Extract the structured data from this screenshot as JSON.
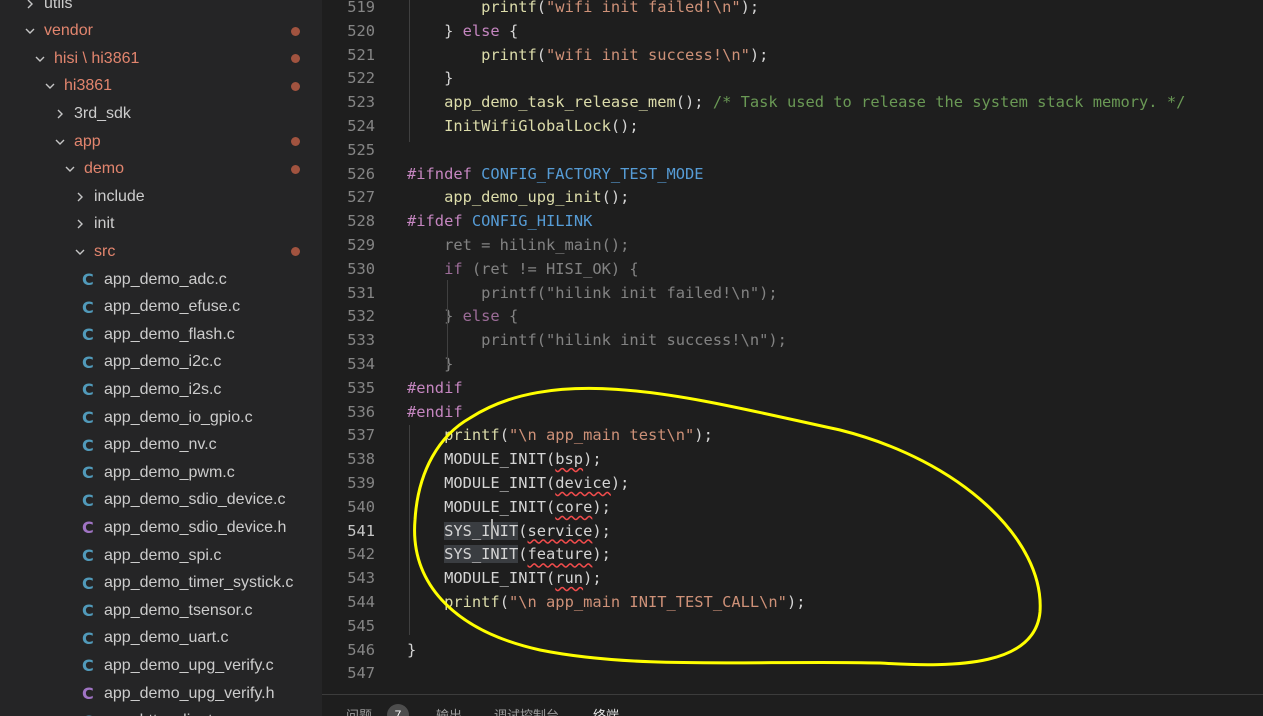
{
  "sidebar": {
    "items": [
      {
        "label": "utils",
        "kind": "folder",
        "expanded": false,
        "indent": 1,
        "modified": false
      },
      {
        "label": "vendor",
        "kind": "folder",
        "expanded": true,
        "indent": 1,
        "modified": true
      },
      {
        "label": "hisi \\ hi3861",
        "kind": "folder",
        "expanded": true,
        "indent": 2,
        "modified": true
      },
      {
        "label": "hi3861",
        "kind": "folder",
        "expanded": true,
        "indent": 3,
        "modified": true
      },
      {
        "label": "3rd_sdk",
        "kind": "folder",
        "expanded": false,
        "indent": 4,
        "modified": false
      },
      {
        "label": "app",
        "kind": "folder",
        "expanded": true,
        "indent": 4,
        "modified": true
      },
      {
        "label": "demo",
        "kind": "folder",
        "expanded": true,
        "indent": 5,
        "modified": true
      },
      {
        "label": "include",
        "kind": "folder",
        "expanded": false,
        "indent": 6,
        "modified": false
      },
      {
        "label": "init",
        "kind": "folder",
        "expanded": false,
        "indent": 6,
        "modified": false
      },
      {
        "label": "src",
        "kind": "folder",
        "expanded": true,
        "indent": 6,
        "modified": true
      },
      {
        "label": "app_demo_adc.c",
        "kind": "c",
        "indent": 7
      },
      {
        "label": "app_demo_efuse.c",
        "kind": "c",
        "indent": 7
      },
      {
        "label": "app_demo_flash.c",
        "kind": "c",
        "indent": 7
      },
      {
        "label": "app_demo_i2c.c",
        "kind": "c",
        "indent": 7
      },
      {
        "label": "app_demo_i2s.c",
        "kind": "c",
        "indent": 7
      },
      {
        "label": "app_demo_io_gpio.c",
        "kind": "c",
        "indent": 7
      },
      {
        "label": "app_demo_nv.c",
        "kind": "c",
        "indent": 7
      },
      {
        "label": "app_demo_pwm.c",
        "kind": "c",
        "indent": 7
      },
      {
        "label": "app_demo_sdio_device.c",
        "kind": "c",
        "indent": 7
      },
      {
        "label": "app_demo_sdio_device.h",
        "kind": "h",
        "indent": 7
      },
      {
        "label": "app_demo_spi.c",
        "kind": "c",
        "indent": 7
      },
      {
        "label": "app_demo_timer_systick.c",
        "kind": "c",
        "indent": 7
      },
      {
        "label": "app_demo_tsensor.c",
        "kind": "c",
        "indent": 7
      },
      {
        "label": "app_demo_uart.c",
        "kind": "c",
        "indent": 7
      },
      {
        "label": "app_demo_upg_verify.c",
        "kind": "c",
        "indent": 7
      },
      {
        "label": "app_demo_upg_verify.h",
        "kind": "h",
        "indent": 7
      },
      {
        "label": "app_http_client.c",
        "kind": "c",
        "indent": 7
      }
    ]
  },
  "file_icons": {
    "c": "C",
    "h": "C"
  },
  "editor": {
    "active_line": "541",
    "lines": [
      {
        "num": "519",
        "tokens": [
          {
            "t": "        "
          },
          {
            "t": "printf",
            "c": "fn"
          },
          {
            "t": "("
          },
          {
            "t": "\"wifi init failed!\\n\"",
            "c": "str"
          },
          {
            "t": ");"
          }
        ]
      },
      {
        "num": "520",
        "tokens": [
          {
            "t": "    } "
          },
          {
            "t": "else",
            "c": "kw"
          },
          {
            "t": " {"
          }
        ]
      },
      {
        "num": "521",
        "tokens": [
          {
            "t": "        "
          },
          {
            "t": "printf",
            "c": "fn"
          },
          {
            "t": "("
          },
          {
            "t": "\"wifi init success!\\n\"",
            "c": "str"
          },
          {
            "t": ");"
          }
        ]
      },
      {
        "num": "522",
        "tokens": [
          {
            "t": "    }"
          }
        ]
      },
      {
        "num": "523",
        "tokens": [
          {
            "t": "    "
          },
          {
            "t": "app_demo_task_release_mem",
            "c": "fn"
          },
          {
            "t": "(); "
          },
          {
            "t": "/* Task used to release the system stack memory. */",
            "c": "cm"
          }
        ]
      },
      {
        "num": "524",
        "tokens": [
          {
            "t": "    "
          },
          {
            "t": "InitWifiGlobalLock",
            "c": "fn"
          },
          {
            "t": "();"
          }
        ]
      },
      {
        "num": "525",
        "tokens": []
      },
      {
        "num": "526",
        "tokens": [
          {
            "t": "#ifndef",
            "c": "kw"
          },
          {
            "t": " "
          },
          {
            "t": "CONFIG_FACTORY_TEST_MODE",
            "c": "mac"
          }
        ]
      },
      {
        "num": "527",
        "tokens": [
          {
            "t": "    "
          },
          {
            "t": "app_demo_upg_init",
            "c": "fn"
          },
          {
            "t": "();"
          }
        ]
      },
      {
        "num": "528",
        "tokens": [
          {
            "t": "#ifdef",
            "c": "kw"
          },
          {
            "t": " "
          },
          {
            "t": "CONFIG_HILINK",
            "c": "mac"
          }
        ]
      },
      {
        "num": "529",
        "tokens": [
          {
            "t": "    ret = hilink_main();",
            "c": "dim"
          }
        ]
      },
      {
        "num": "530",
        "tokens": [
          {
            "t": "    "
          },
          {
            "t": "if",
            "c": "kwd"
          },
          {
            "t": " (ret != HISI_OK) {",
            "c": "dim"
          }
        ]
      },
      {
        "num": "531",
        "tokens": [
          {
            "t": "        printf(\"hilink init failed!\\n\");",
            "c": "dim"
          }
        ]
      },
      {
        "num": "532",
        "tokens": [
          {
            "t": "    } ",
            "c": "dim"
          },
          {
            "t": "else",
            "c": "kwd"
          },
          {
            "t": " {",
            "c": "dim"
          }
        ]
      },
      {
        "num": "533",
        "tokens": [
          {
            "t": "        printf(\"hilink init success!\\n\");",
            "c": "dim"
          }
        ]
      },
      {
        "num": "534",
        "tokens": [
          {
            "t": "    }",
            "c": "dim"
          }
        ]
      },
      {
        "num": "535",
        "tokens": [
          {
            "t": "#endif",
            "c": "kw"
          }
        ]
      },
      {
        "num": "536",
        "tokens": [
          {
            "t": "#endif",
            "c": "kw"
          }
        ]
      },
      {
        "num": "537",
        "tokens": [
          {
            "t": "    "
          },
          {
            "t": "printf",
            "c": "fn"
          },
          {
            "t": "("
          },
          {
            "t": "\"\\n app_main test\\n\"",
            "c": "str"
          },
          {
            "t": ");"
          }
        ]
      },
      {
        "num": "538",
        "tokens": [
          {
            "t": "    MODULE_INIT("
          },
          {
            "t": "bsp",
            "c": "sq"
          },
          {
            "t": ");"
          }
        ]
      },
      {
        "num": "539",
        "tokens": [
          {
            "t": "    MODULE_INIT("
          },
          {
            "t": "device",
            "c": "sq"
          },
          {
            "t": ");"
          }
        ]
      },
      {
        "num": "540",
        "tokens": [
          {
            "t": "    MODULE_INIT("
          },
          {
            "t": "core",
            "c": "sq"
          },
          {
            "t": ");"
          }
        ]
      },
      {
        "num": "541",
        "tokens": [
          {
            "t": "    "
          },
          {
            "t": "SYS_INIT",
            "c": "hl"
          },
          {
            "t": "("
          },
          {
            "t": "service",
            "c": "sq"
          },
          {
            "t": ");"
          }
        ]
      },
      {
        "num": "542",
        "tokens": [
          {
            "t": "    "
          },
          {
            "t": "SYS_INIT",
            "c": "hl"
          },
          {
            "t": "("
          },
          {
            "t": "feature",
            "c": "sq"
          },
          {
            "t": ");"
          }
        ]
      },
      {
        "num": "543",
        "tokens": [
          {
            "t": "    MODULE_INIT("
          },
          {
            "t": "run",
            "c": "sq"
          },
          {
            "t": ");"
          }
        ]
      },
      {
        "num": "544",
        "tokens": [
          {
            "t": "    "
          },
          {
            "t": "printf",
            "c": "fn"
          },
          {
            "t": "("
          },
          {
            "t": "\"\\n app_main INIT_TEST_CALL\\n\"",
            "c": "str"
          },
          {
            "t": ");"
          }
        ]
      },
      {
        "num": "545",
        "tokens": []
      },
      {
        "num": "546",
        "tokens": [
          {
            "t": "}"
          }
        ]
      },
      {
        "num": "547",
        "tokens": []
      }
    ]
  },
  "panel": {
    "tabs": [
      {
        "label": "问题",
        "active": false
      },
      {
        "label": "输出",
        "active": false
      },
      {
        "label": "调试控制台",
        "active": false
      },
      {
        "label": "终端",
        "active": true
      }
    ],
    "problems_count": "7"
  },
  "colors": {
    "modified_dot": "#a1533f",
    "modified_text": "#e2856e",
    "annotation": "#ffff00"
  }
}
